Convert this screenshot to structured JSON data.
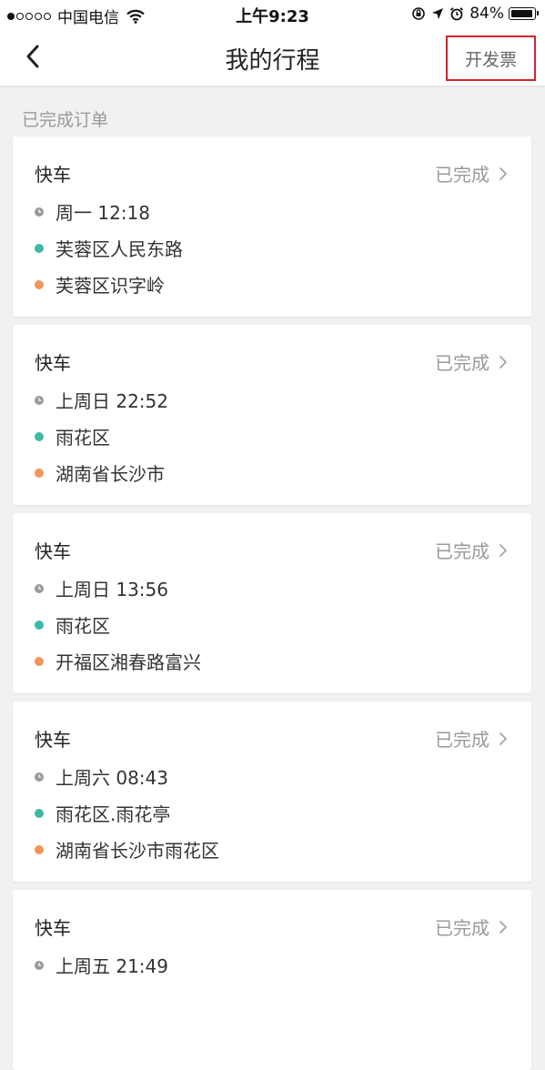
{
  "status_bar": {
    "carrier": "中国电信",
    "time": "上午9:23",
    "battery_text": "84%",
    "battery_level": 0.84,
    "icons": [
      "signal-dots",
      "wifi-icon",
      "orientation-lock-icon",
      "location-arrow-icon",
      "alarm-icon",
      "battery-icon"
    ]
  },
  "nav": {
    "title": "我的行程",
    "back_icon": "chevron-left-icon",
    "invoice_label": "开发票",
    "highlight_color": "#d3242b"
  },
  "section": {
    "header": "已完成订单"
  },
  "colors": {
    "start_dot": "#3cb9a6",
    "end_dot": "#f2955a",
    "time_icon": "#9a9a9a"
  },
  "orders": [
    {
      "type": "快车",
      "status": "已完成",
      "time": "周一 12:18",
      "from": "芙蓉区人民东路",
      "to": "芙蓉区识字岭"
    },
    {
      "type": "快车",
      "status": "已完成",
      "time": "上周日 22:52",
      "from": "雨花区",
      "to": "湖南省长沙市"
    },
    {
      "type": "快车",
      "status": "已完成",
      "time": "上周日 13:56",
      "from": "雨花区",
      "to": "开福区湘春路富兴"
    },
    {
      "type": "快车",
      "status": "已完成",
      "time": "上周六 08:43",
      "from": "雨花区.雨花亭",
      "to": "湖南省长沙市雨花区"
    },
    {
      "type": "快车",
      "status": "已完成",
      "time": "上周五 21:49",
      "from": "",
      "to": ""
    }
  ]
}
